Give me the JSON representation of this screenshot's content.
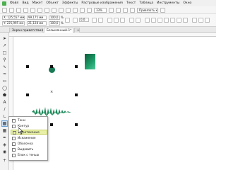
{
  "menubar": {
    "items": [
      "Файл",
      "Вид",
      "Макет",
      "Объект",
      "Эффекты",
      "Растровые изображения",
      "Текст",
      "Таблица",
      "Инструменты",
      "Окно",
      "Справка"
    ]
  },
  "toolbar": {
    "zoom": "33%",
    "snap": "Привязать к"
  },
  "propbar": {
    "x_value": "X: 125,557 мм",
    "y_value": "Y: 225,995 мм",
    "w_value": "99,175 мм",
    "h_value": "21,128 мм",
    "scale_x": "100,0",
    "scale_y": "100,0",
    "percent": "%",
    "angle": "0,0"
  },
  "tabs": [
    {
      "label": "Экран приветствия"
    },
    {
      "label": "Безымянный-1*",
      "close": "×"
    },
    {
      "label": "+"
    }
  ],
  "flyout": {
    "items": [
      "Тени",
      "Контур",
      "Перетекание",
      "Искажение",
      "Оболочка",
      "Выдавить",
      "Блок с тенью"
    ]
  }
}
